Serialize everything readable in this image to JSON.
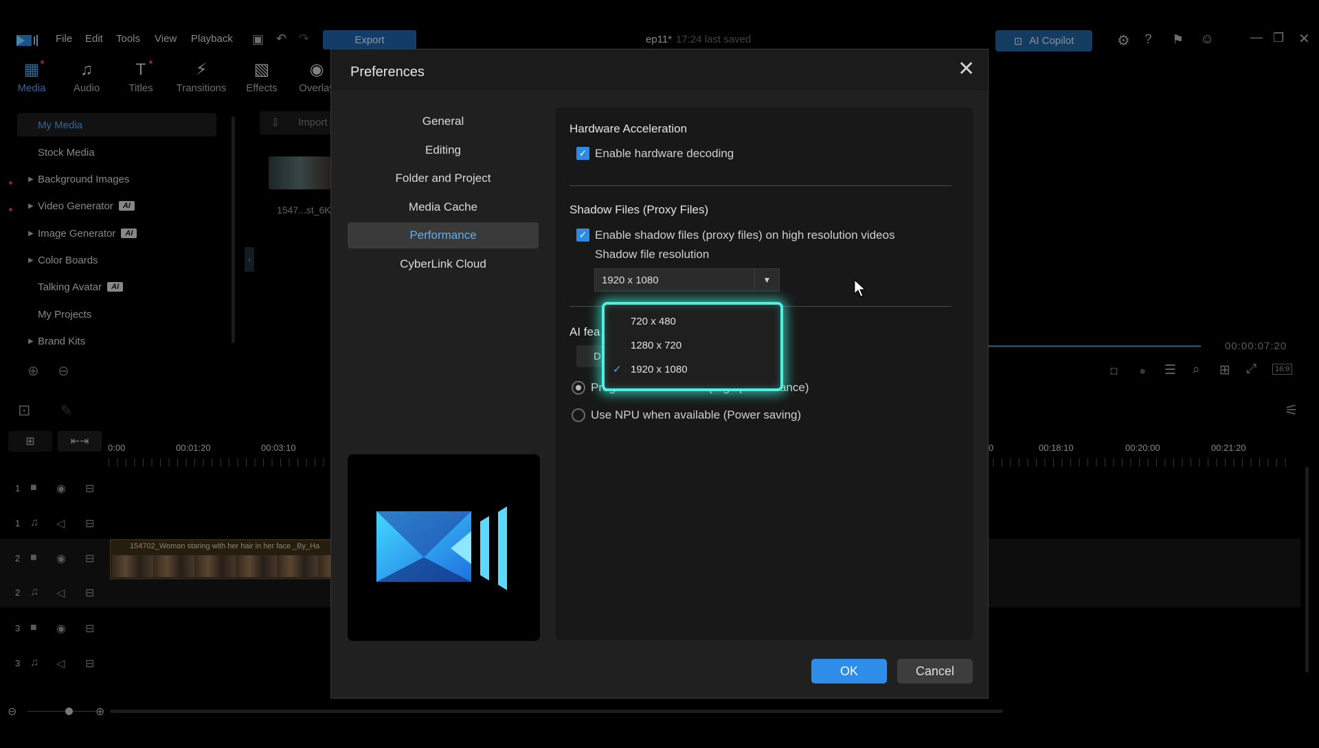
{
  "app": {
    "menu": [
      "File",
      "Edit",
      "Tools",
      "View",
      "Playback"
    ],
    "export_label": "Export",
    "project_name": "ep11*",
    "saved_status": "17:24 last saved",
    "copilot_label": "AI Copilot",
    "window_icons": [
      "settings-icon",
      "help-icon",
      "notification-icon",
      "account-icon",
      "minimize-icon",
      "restore-icon",
      "close-icon"
    ]
  },
  "tabs": [
    {
      "label": "Media",
      "icon": "media-icon"
    },
    {
      "label": "Audio",
      "icon": "audio-icon"
    },
    {
      "label": "Titles",
      "icon": "titles-icon"
    },
    {
      "label": "Transitions",
      "icon": "transitions-icon"
    },
    {
      "label": "Effects",
      "icon": "effects-icon"
    },
    {
      "label": "Overlay",
      "icon": "overlay-icon"
    }
  ],
  "library": {
    "items": [
      {
        "label": "My Media",
        "ai": ""
      },
      {
        "label": "Stock Media",
        "ai": ""
      },
      {
        "label": "Background Images",
        "ai": ""
      },
      {
        "label": "Video Generator",
        "ai": "AI"
      },
      {
        "label": "Image Generator",
        "ai": "AI"
      },
      {
        "label": "Color Boards",
        "ai": ""
      },
      {
        "label": "Talking Avatar",
        "ai": "AI"
      },
      {
        "label": "My Projects",
        "ai": ""
      },
      {
        "label": "Brand Kits",
        "ai": ""
      }
    ],
    "import_label": "Import",
    "thumb_caption": "1547...st_6K"
  },
  "timeline": {
    "ruler_left": [
      "0:00",
      "00:01:20",
      "00:03:10"
    ],
    "ruler_right": [
      "0",
      "00:18:10",
      "00:20:00",
      "00:21:20"
    ],
    "tracks": [
      "1",
      "1",
      "2",
      "2",
      "3",
      "3"
    ],
    "clip_label": "154702_Woman staring with her hair in her face _By_Ha",
    "preview_time": "00:00:07:20",
    "aspect_ratio": "16:9"
  },
  "dialog": {
    "title": "Preferences",
    "nav": [
      "General",
      "Editing",
      "Folder and Project",
      "Media Cache",
      "Performance",
      "CyberLink Cloud"
    ],
    "hw_title": "Hardware Acceleration",
    "hw_decoding": "Enable hardware decoding",
    "shadow_title": "Shadow Files (Proxy Files)",
    "shadow_enable": "Enable shadow files (proxy files) on high resolution videos",
    "shadow_res_label": "Shadow file resolution",
    "shadow_res_value": "1920 x 1080",
    "resolution_options": [
      "720 x 480",
      "1280 x 720",
      "1920 x 1080"
    ],
    "ai_title": "AI fea",
    "ai_button": "D",
    "radio_auto": "Program auto decides (High performance)",
    "radio_npu": "Use NPU when available (Power saving)",
    "ok_label": "OK",
    "cancel_label": "Cancel"
  }
}
